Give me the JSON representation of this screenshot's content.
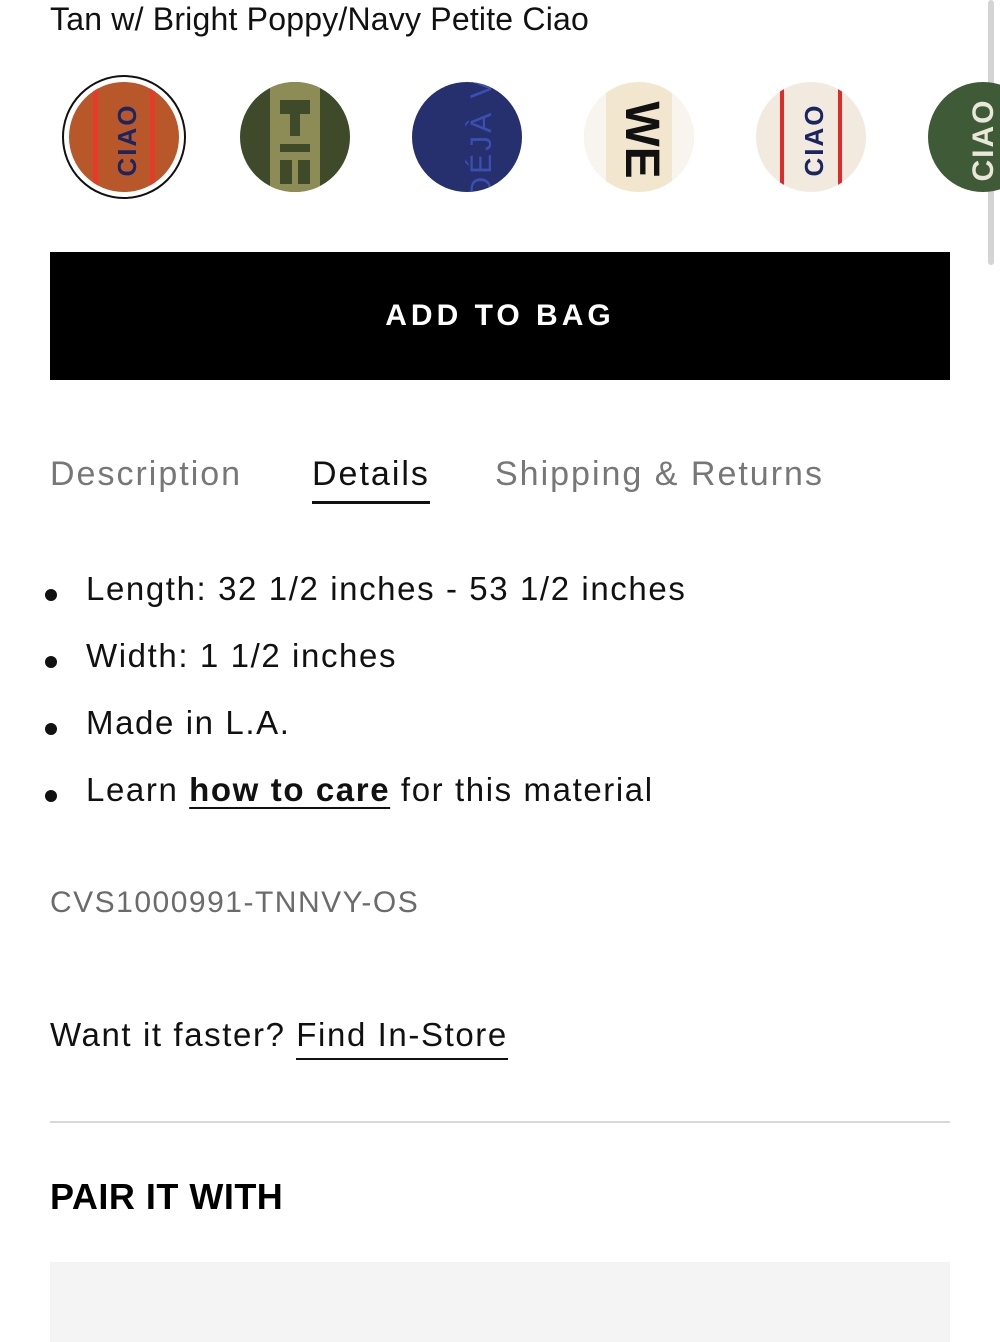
{
  "product": {
    "color_name": "Tan w/ Bright Poppy/Navy Petite Ciao"
  },
  "swatches": [
    {
      "name": "Tan w/ Bright Poppy/Navy Petite Ciao",
      "selected": true,
      "bg": "#b8572a",
      "stripe": "#e63a2a",
      "text_color": "#1b2660",
      "label": "CIAO"
    },
    {
      "name": "Olive pattern",
      "selected": false,
      "bg": "#3f4a2a",
      "stripe": "#9a9a58",
      "text_color": "#a7a36b",
      "label": ""
    },
    {
      "name": "Navy Deja Vu",
      "selected": false,
      "bg": "#26306e",
      "stripe": "#26306e",
      "text_color": "#3a4fb0",
      "label": "DÉJÀ"
    },
    {
      "name": "Cream WE",
      "selected": false,
      "bg": "#f2e6cf",
      "stripe": "#f2e6cf",
      "text_color": "#111111",
      "label": "WE"
    },
    {
      "name": "Cream Ciao",
      "selected": false,
      "bg": "#f3eadf",
      "stripe": "#e02a2a",
      "text_color": "#1b2660",
      "label": "CIAO"
    },
    {
      "name": "Olive Ciao",
      "selected": false,
      "bg": "#3f5a36",
      "stripe": "#3f5a36",
      "text_color": "#e9e6da",
      "label": "CIAO"
    }
  ],
  "actions": {
    "add_to_bag": "ADD TO BAG"
  },
  "tabs": [
    {
      "label": "Description",
      "active": false
    },
    {
      "label": "Details",
      "active": true
    },
    {
      "label": "Shipping & Returns",
      "active": false
    }
  ],
  "details": {
    "items": [
      "Length: 32 1/2 inches - 53 1/2 inches",
      "Width: 1 1/2 inches",
      "Made in L.A."
    ],
    "care_prefix": "Learn ",
    "care_link": "how to care",
    "care_suffix": " for this material",
    "sku": "CVS1000991-TNNVY-OS"
  },
  "store": {
    "prompt": "Want it faster? ",
    "link": "Find In-Store"
  },
  "pair": {
    "heading": "PAIR IT WITH"
  }
}
